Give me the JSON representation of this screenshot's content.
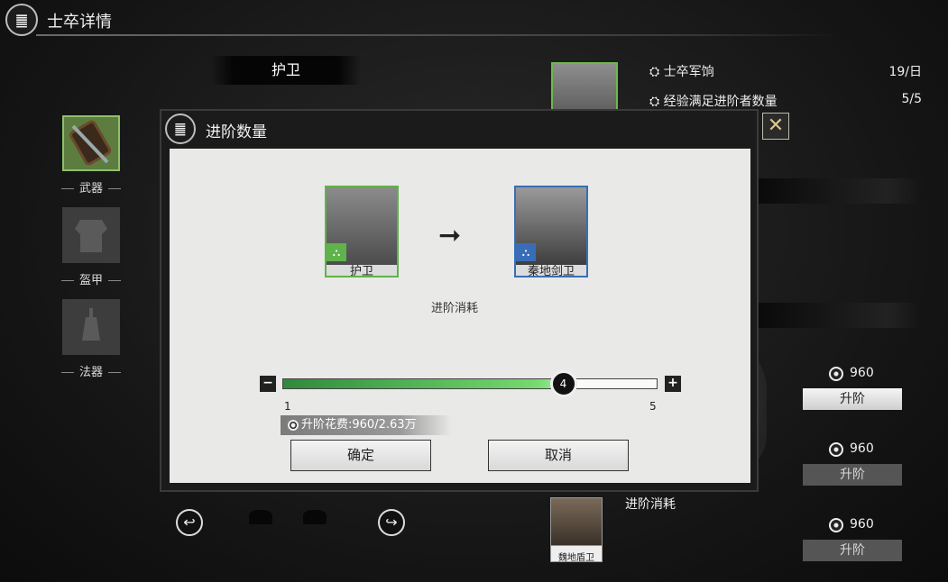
{
  "header": {
    "title": "士卒详情"
  },
  "unit": {
    "name": "护卫"
  },
  "equipment": [
    {
      "label": "武器"
    },
    {
      "label": "盔甲"
    },
    {
      "label": "法器"
    }
  ],
  "info": {
    "rows": [
      {
        "label": "士卒军饷",
        "value": "19/日"
      },
      {
        "label": "经验满足进阶者数量",
        "value": "5/5"
      }
    ]
  },
  "upgrade_rows": [
    {
      "cost": "960",
      "button": "升阶",
      "state": "active"
    },
    {
      "cost": "960",
      "button": "升阶",
      "state": "disabled"
    },
    {
      "cost": "960",
      "button": "升阶",
      "state": "disabled"
    }
  ],
  "bottom": {
    "consume_label": "进阶消耗",
    "card_label": "魏地盾卫"
  },
  "dialog": {
    "title": "进阶数量",
    "from_card": {
      "label": "护卫",
      "border": "#5fb34a"
    },
    "to_card": {
      "label": "秦地剑卫",
      "border": "#3a6db8"
    },
    "consume_label": "进阶消耗",
    "slider": {
      "min": "1",
      "max": "5",
      "value": "4",
      "fraction": 0.75
    },
    "cost_text": "升阶花费:960/2.63万",
    "confirm": "确定",
    "cancel": "取消"
  }
}
